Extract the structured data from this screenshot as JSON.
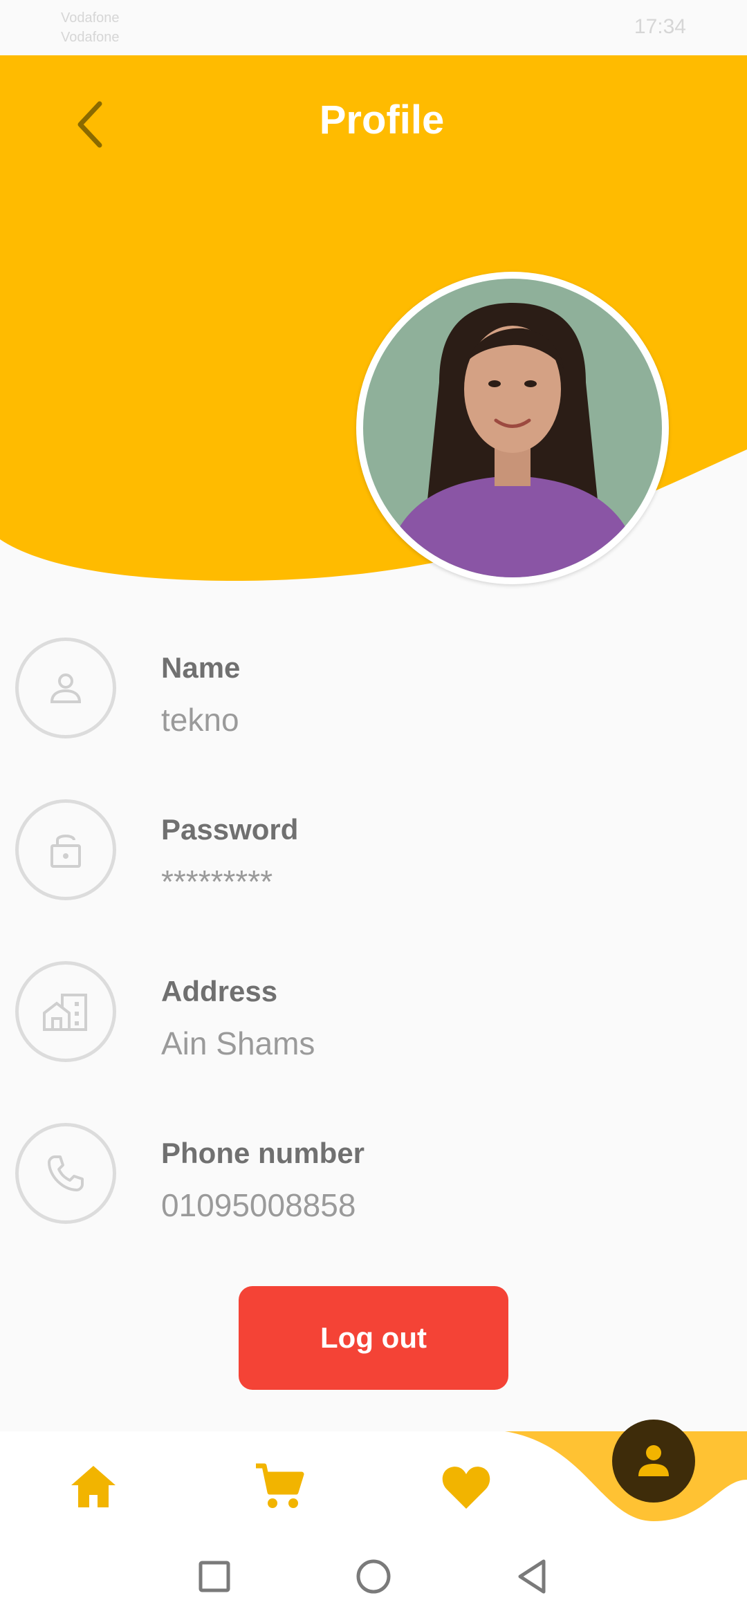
{
  "status_bar": {
    "carrier_line1": "Vodafone",
    "carrier_line2": "Vodafone",
    "time": "17:34"
  },
  "header": {
    "title": "Profile"
  },
  "fields": [
    {
      "label": "Name",
      "value": "tekno",
      "icon": "person-icon"
    },
    {
      "label": "Password",
      "value": "*********",
      "icon": "lock-icon"
    },
    {
      "label": "Address",
      "value": "Ain Shams",
      "icon": "building-icon"
    },
    {
      "label": "Phone number",
      "value": "01095008858",
      "icon": "phone-icon"
    }
  ],
  "logout_label": "Log out",
  "bottom_nav": {
    "items": [
      "home-icon",
      "cart-icon",
      "heart-icon",
      "person-icon"
    ],
    "active": "profile"
  },
  "colors": {
    "accent": "#FFBB00",
    "logout": "#F44336",
    "active_nav_bg": "#3E2C0A"
  }
}
